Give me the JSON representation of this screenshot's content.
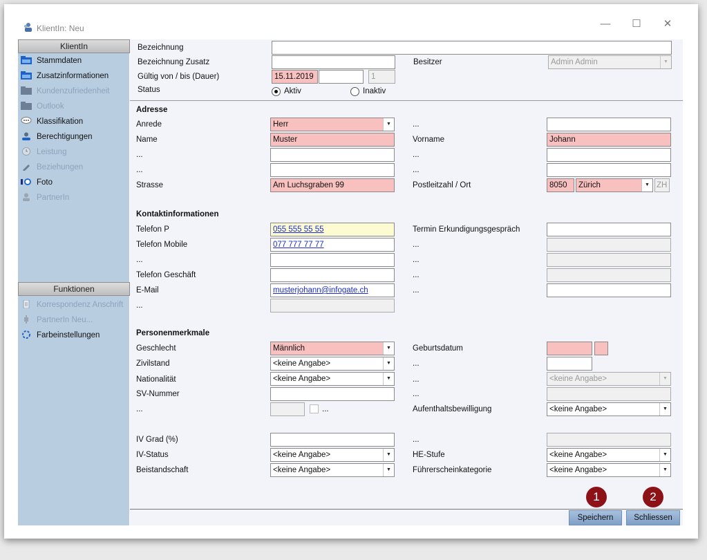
{
  "window": {
    "title": "KlientIn: Neu",
    "minimize": "—",
    "maximize": "☐",
    "close": "✕"
  },
  "sidebar": {
    "header": "KlientIn",
    "items": [
      {
        "label": "Stammdaten",
        "enabled": true
      },
      {
        "label": "Zusatzinformationen",
        "enabled": true
      },
      {
        "label": "Kundenzufriedenheit",
        "enabled": false
      },
      {
        "label": "Outlook",
        "enabled": false
      },
      {
        "label": "Klassifikation",
        "enabled": true
      },
      {
        "label": "Berechtigungen",
        "enabled": true
      },
      {
        "label": "Leistung",
        "enabled": false
      },
      {
        "label": "Beziehungen",
        "enabled": false
      },
      {
        "label": "Foto",
        "enabled": true
      },
      {
        "label": "PartnerIn",
        "enabled": false
      }
    ],
    "functions_header": "Funktionen",
    "functions": [
      {
        "label": "Korrespondenz Anschrift",
        "enabled": false
      },
      {
        "label": "PartnerIn Neu...",
        "enabled": false
      },
      {
        "label": "Farbeinstellungen",
        "enabled": true
      }
    ]
  },
  "header": {
    "bezeichnung_label": "Bezeichnung",
    "bezeichnung_value": "",
    "bezeichnung_zusatz_label": "Bezeichnung Zusatz",
    "bezeichnung_zusatz_value": "",
    "besitzer_label": "Besitzer",
    "besitzer_value": "Admin Admin",
    "gueltig_label": "Gültig von / bis (Dauer)",
    "gueltig_von": "15.11.2019",
    "gueltig_bis": "",
    "dauer": "1",
    "status_label": "Status",
    "status_options": [
      "Aktiv",
      "Inaktiv"
    ],
    "status_selected": "Aktiv"
  },
  "adresse": {
    "section_title": "Adresse",
    "anrede_label": "Anrede",
    "anrede_value": "Herr",
    "dots": "...",
    "name_label": "Name",
    "name_value": "Muster",
    "vorname_label": "Vorname",
    "vorname_value": "Johann",
    "strasse_label": "Strasse",
    "strasse_value": "Am Luchsgraben 99",
    "plz_ort_label": "Postleitzahl / Ort",
    "plz_value": "8050",
    "ort_value": "Zürich",
    "kanton_value": "ZH"
  },
  "kontakt": {
    "section_title": "Kontaktinformationen",
    "telefon_p_label": "Telefon P",
    "telefon_p_value": "055 555 55 55",
    "telefon_mobile_label": "Telefon Mobile",
    "telefon_mobile_value": "077 777 77 77",
    "telefon_geschaeft_label": "Telefon Geschäft",
    "telefon_geschaeft_value": "",
    "email_label": "E-Mail",
    "email_value": "musterjohann@infogate.ch",
    "termin_label": "Termin Erkundigungsgespräch",
    "termin_value": ""
  },
  "personen": {
    "section_title": "Personenmerkmale",
    "geschlecht_label": "Geschlecht",
    "geschlecht_value": "Männlich",
    "geburtsdatum_label": "Geburtsdatum",
    "zivilstand_label": "Zivilstand",
    "zivilstand_value": "<keine Angabe>",
    "nationalitaet_label": "Nationalität",
    "nationalitaet_value": "<keine Angabe>",
    "nationalitaet2_value": "<keine Angabe>",
    "sv_label": "SV-Nummer",
    "aufenthalt_label": "Aufenthaltsbewilligung",
    "aufenthalt_value": "<keine Angabe>",
    "iv_grad_label": "IV Grad (%)",
    "iv_status_label": "IV-Status",
    "iv_status_value": "<keine Angabe>",
    "he_stufe_label": "HE-Stufe",
    "he_stufe_value": "<keine Angabe>",
    "beistandschaft_label": "Beistandschaft",
    "beistandschaft_value": "<keine Angabe>",
    "fuehrerschein_label": "Führerscheinkategorie",
    "fuehrerschein_value": "<keine Angabe>"
  },
  "footer": {
    "save_label": "Speichern",
    "close_label": "Schliessen",
    "badge_save": "1",
    "badge_close": "2"
  },
  "colors": {
    "required": "#f9c0c0",
    "highlight": "#fcfbd2",
    "sidebar": "#b8cde0",
    "badge": "#8d1218"
  }
}
